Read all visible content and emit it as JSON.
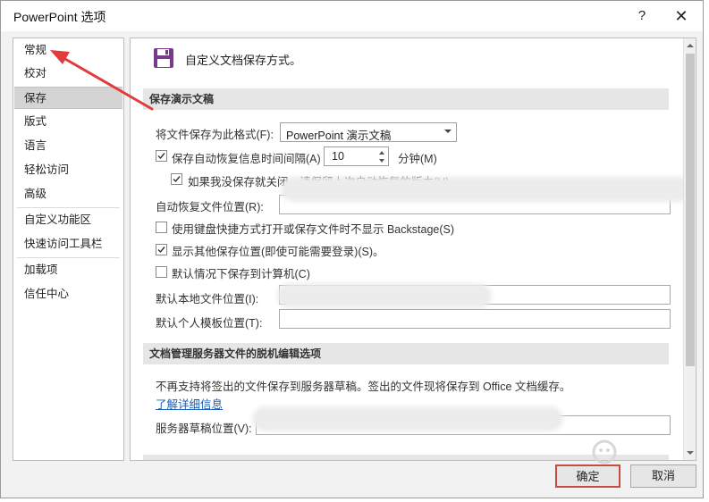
{
  "window": {
    "title": "PowerPoint 选项",
    "help": "?",
    "close": "✕"
  },
  "sidebar": {
    "items": [
      {
        "label": "常规"
      },
      {
        "label": "校对"
      },
      {
        "label": "保存"
      },
      {
        "label": "版式"
      },
      {
        "label": "语言"
      },
      {
        "label": "轻松访问"
      },
      {
        "label": "高级"
      },
      {
        "label": "自定义功能区"
      },
      {
        "label": "快速访问工具栏"
      },
      {
        "label": "加载项"
      },
      {
        "label": "信任中心"
      }
    ],
    "active": "保存"
  },
  "main": {
    "header": "自定义文档保存方式。",
    "section1": {
      "title": "保存演示文稿",
      "save_format_label": "将文件保存为此格式(F):",
      "save_format_value": "PowerPoint 演示文稿",
      "autorecover_label": "保存自动恢复信息时间间隔(A)",
      "autorecover_checked": true,
      "autorecover_minutes": "10",
      "minutes_label": "分钟(M)",
      "keep_last_label": "如果我没保存就关闭，请保留上次自动恢复的版本(U)",
      "keep_last_checked": true,
      "autorecover_location_label": "自动恢复文件位置(R):",
      "keyboard_shortcut_label": "使用键盘快捷方式打开或保存文件时不显示 Backstage(S)",
      "keyboard_shortcut_checked": false,
      "show_other_locations_label": "显示其他保存位置(即使可能需要登录)(S)。",
      "show_other_locations_checked": true,
      "save_to_computer_label": "默认情况下保存到计算机(C)",
      "save_to_computer_checked": false,
      "default_local_location_label": "默认本地文件位置(I):",
      "default_template_location_label": "默认个人模板位置(T):"
    },
    "section2": {
      "title": "文档管理服务器文件的脱机编辑选项",
      "info": "不再支持将签出的文件保存到服务器草稿。签出的文件现将保存到 Office 文档缓存。",
      "learn_more": "了解详细信息",
      "server_drafts_label": "服务器草稿位置(V):"
    }
  },
  "buttons": {
    "ok": "确定",
    "cancel": "取消"
  },
  "colors": {
    "accent_purple": "#7a3a8c",
    "annotation_red": "#e23b3b",
    "link": "#1b5fb8"
  }
}
